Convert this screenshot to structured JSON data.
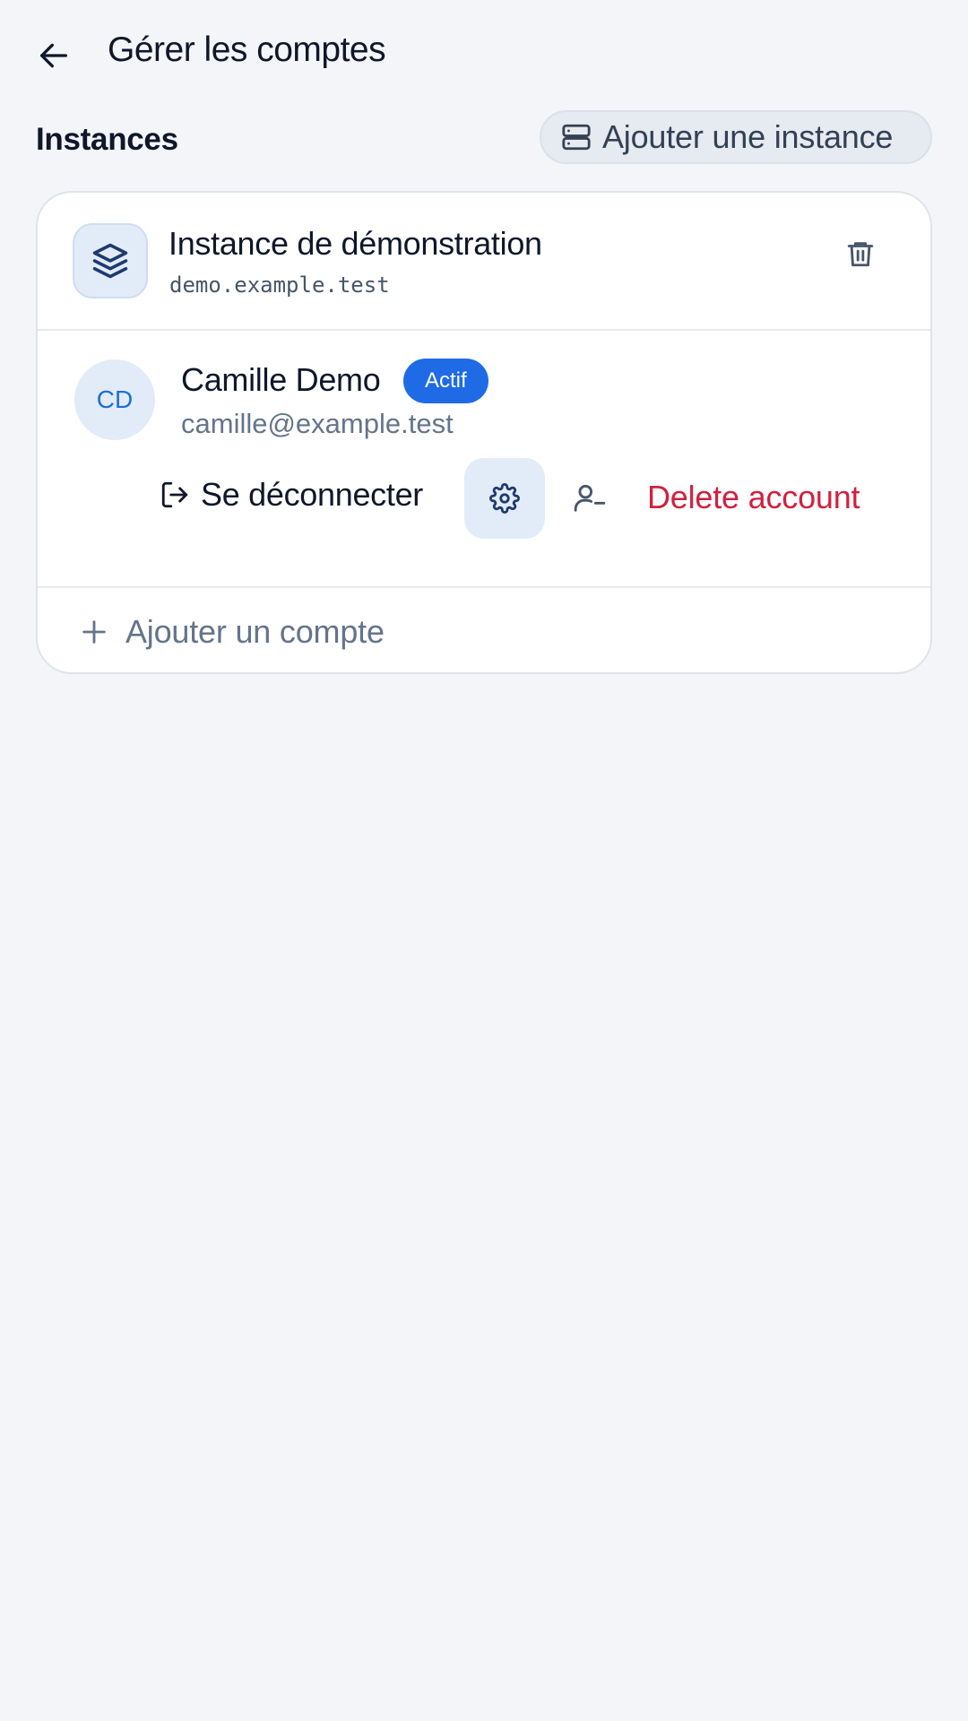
{
  "header": {
    "title": "Gérer les comptes",
    "back_icon": "arrow-left-icon"
  },
  "section": {
    "title": "Instances",
    "add_instance_label": "Ajouter une instance",
    "add_instance_icon": "server-icon"
  },
  "instance": {
    "name": "Instance de démonstration",
    "url": "demo.example.test",
    "icon": "layers-icon",
    "delete_icon": "trash-icon"
  },
  "account": {
    "initials": "CD",
    "name": "Camille Demo",
    "status": "Actif",
    "email": "camille@example.test",
    "actions": {
      "logout_label": "Se déconnecter",
      "logout_icon": "logout-icon",
      "settings_icon": "gear-icon",
      "remove_user_icon": "user-minus-icon",
      "delete_label": "Delete account"
    }
  },
  "add_account": {
    "label": "Ajouter un compte",
    "icon": "plus-icon"
  },
  "colors": {
    "background": "#f3f5f9",
    "accent": "#1f6be6",
    "danger": "#d0213f",
    "muted_text": "#64748b"
  }
}
